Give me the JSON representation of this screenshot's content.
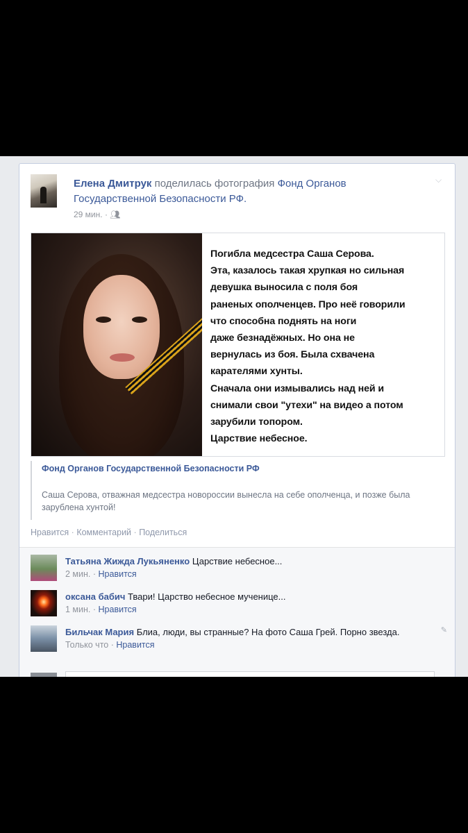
{
  "post": {
    "author": "Елена Дмитрук",
    "action": "поделилась фотография",
    "page": "Фонд Органов Государственной Безопасности РФ.",
    "time": "29 мин.",
    "audience_icon": "friends-icon",
    "menu_icon": "chevron-down-icon"
  },
  "photo_caption_lines": [
    "Погибла медсестра Саша Серова.",
    "Эта, казалось такая хрупкая но сильная",
    "девушка выносила с поля боя",
    "раненых ополченцев. Про неё говорили",
    "что способна поднять на ноги",
    "даже безнадёжных. Но она не",
    "вернулась из боя. Была схвачена",
    "карателями хунты.",
    "Сначала они измывались над ней и",
    "снимали свои \"утехи\" на видео а потом",
    "зарубили топором.",
    "Царствие небесное."
  ],
  "link": {
    "title": "Фонд Органов Государственной Безопасности РФ",
    "description": "Саша Серова, отважная медсестра новороссии вынесла на себе ополченца, и позже была зарублена хунтой!"
  },
  "actions": {
    "like": "Нравится",
    "comment": "Комментарий",
    "share": "Поделиться",
    "separator": "·"
  },
  "comments": [
    {
      "name": "Татьяна Жижда Лукьяненко",
      "text": "Царствие небесное...",
      "time": "2 мин.",
      "like": "Нравится",
      "avatar_color": "#6b8a5a"
    },
    {
      "name": "оксана бабич",
      "text": "Твари! Царство небесное мученице...",
      "time": "1 мин.",
      "like": "Нравится",
      "avatar_color": "#1a0f0c"
    },
    {
      "name": "Бильчак Мария",
      "text": "Блиа, люди, вы странные? На фото Саша Грей. Порно звезда.",
      "time": "Только что",
      "like": "Нравится",
      "avatar_color": "#7a8fa6"
    }
  ],
  "colors": {
    "link_blue": "#3b5998",
    "muted_text": "#90949c",
    "card_border": "#c4cde0",
    "comments_bg": "#f6f7f9"
  }
}
